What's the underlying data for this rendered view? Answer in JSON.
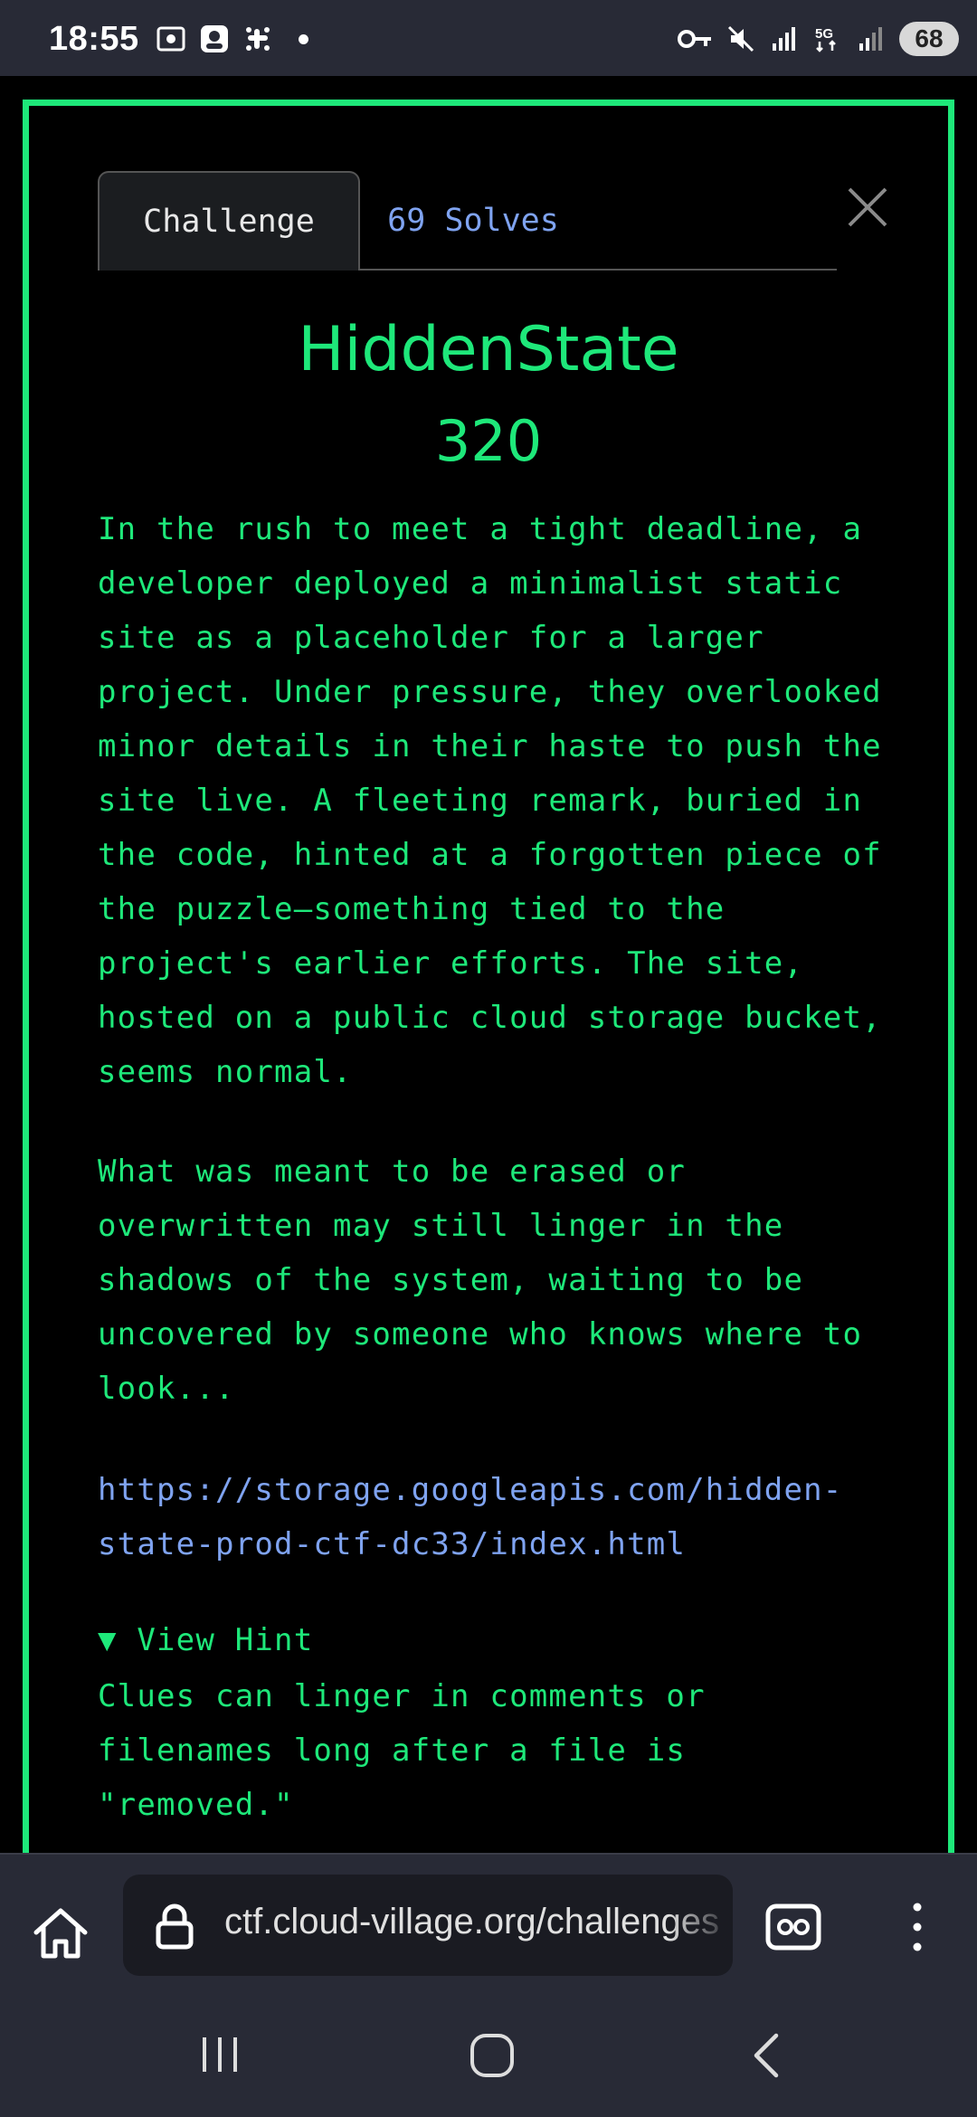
{
  "status_bar": {
    "time": "18:55",
    "battery": "68",
    "left_icons": [
      "screenshot-icon",
      "app-icon",
      "slack-icon",
      "notification-dot"
    ],
    "right_icons": [
      "vpn-key-icon",
      "mute-icon",
      "signal-r-icon",
      "5g-icon",
      "signal-icon"
    ]
  },
  "modal": {
    "tabs": [
      {
        "label": "Challenge",
        "active": true
      },
      {
        "label": "69 Solves",
        "active": false
      }
    ],
    "title": "HiddenState",
    "points": "320",
    "description_p1": "In the rush to meet a tight deadline, a\ndeveloper deployed a minimalist static\nsite as a placeholder for a larger\nproject. Under pressure, they overlooked\nminor details in their haste to push the\nsite live. A fleeting remark, buried in\nthe code, hinted at a forgotten piece of\nthe puzzle—something tied to the\nproject's earlier efforts. The site,\nhosted on a public cloud storage bucket,\nseems normal.",
    "description_p2": "What was meant to be erased or\noverwritten may still linger in the\nshadows of the system, waiting to be\nuncovered by someone who knows where to\nlook...",
    "link": "https://storage.googleapis.com/hidden-\nstate-prod-ctf-dc33/index.html",
    "hint_toggle": "▼ View Hint",
    "hint_text": "Clues can linger in comments or\nfilenames long after a file is\n\"removed.\""
  },
  "browser": {
    "url": "ctf.cloud-village.org/challenges"
  },
  "colors": {
    "accent_green": "#1ee87a",
    "link_blue": "#7fa3f0",
    "bar_bg": "#282a36"
  }
}
